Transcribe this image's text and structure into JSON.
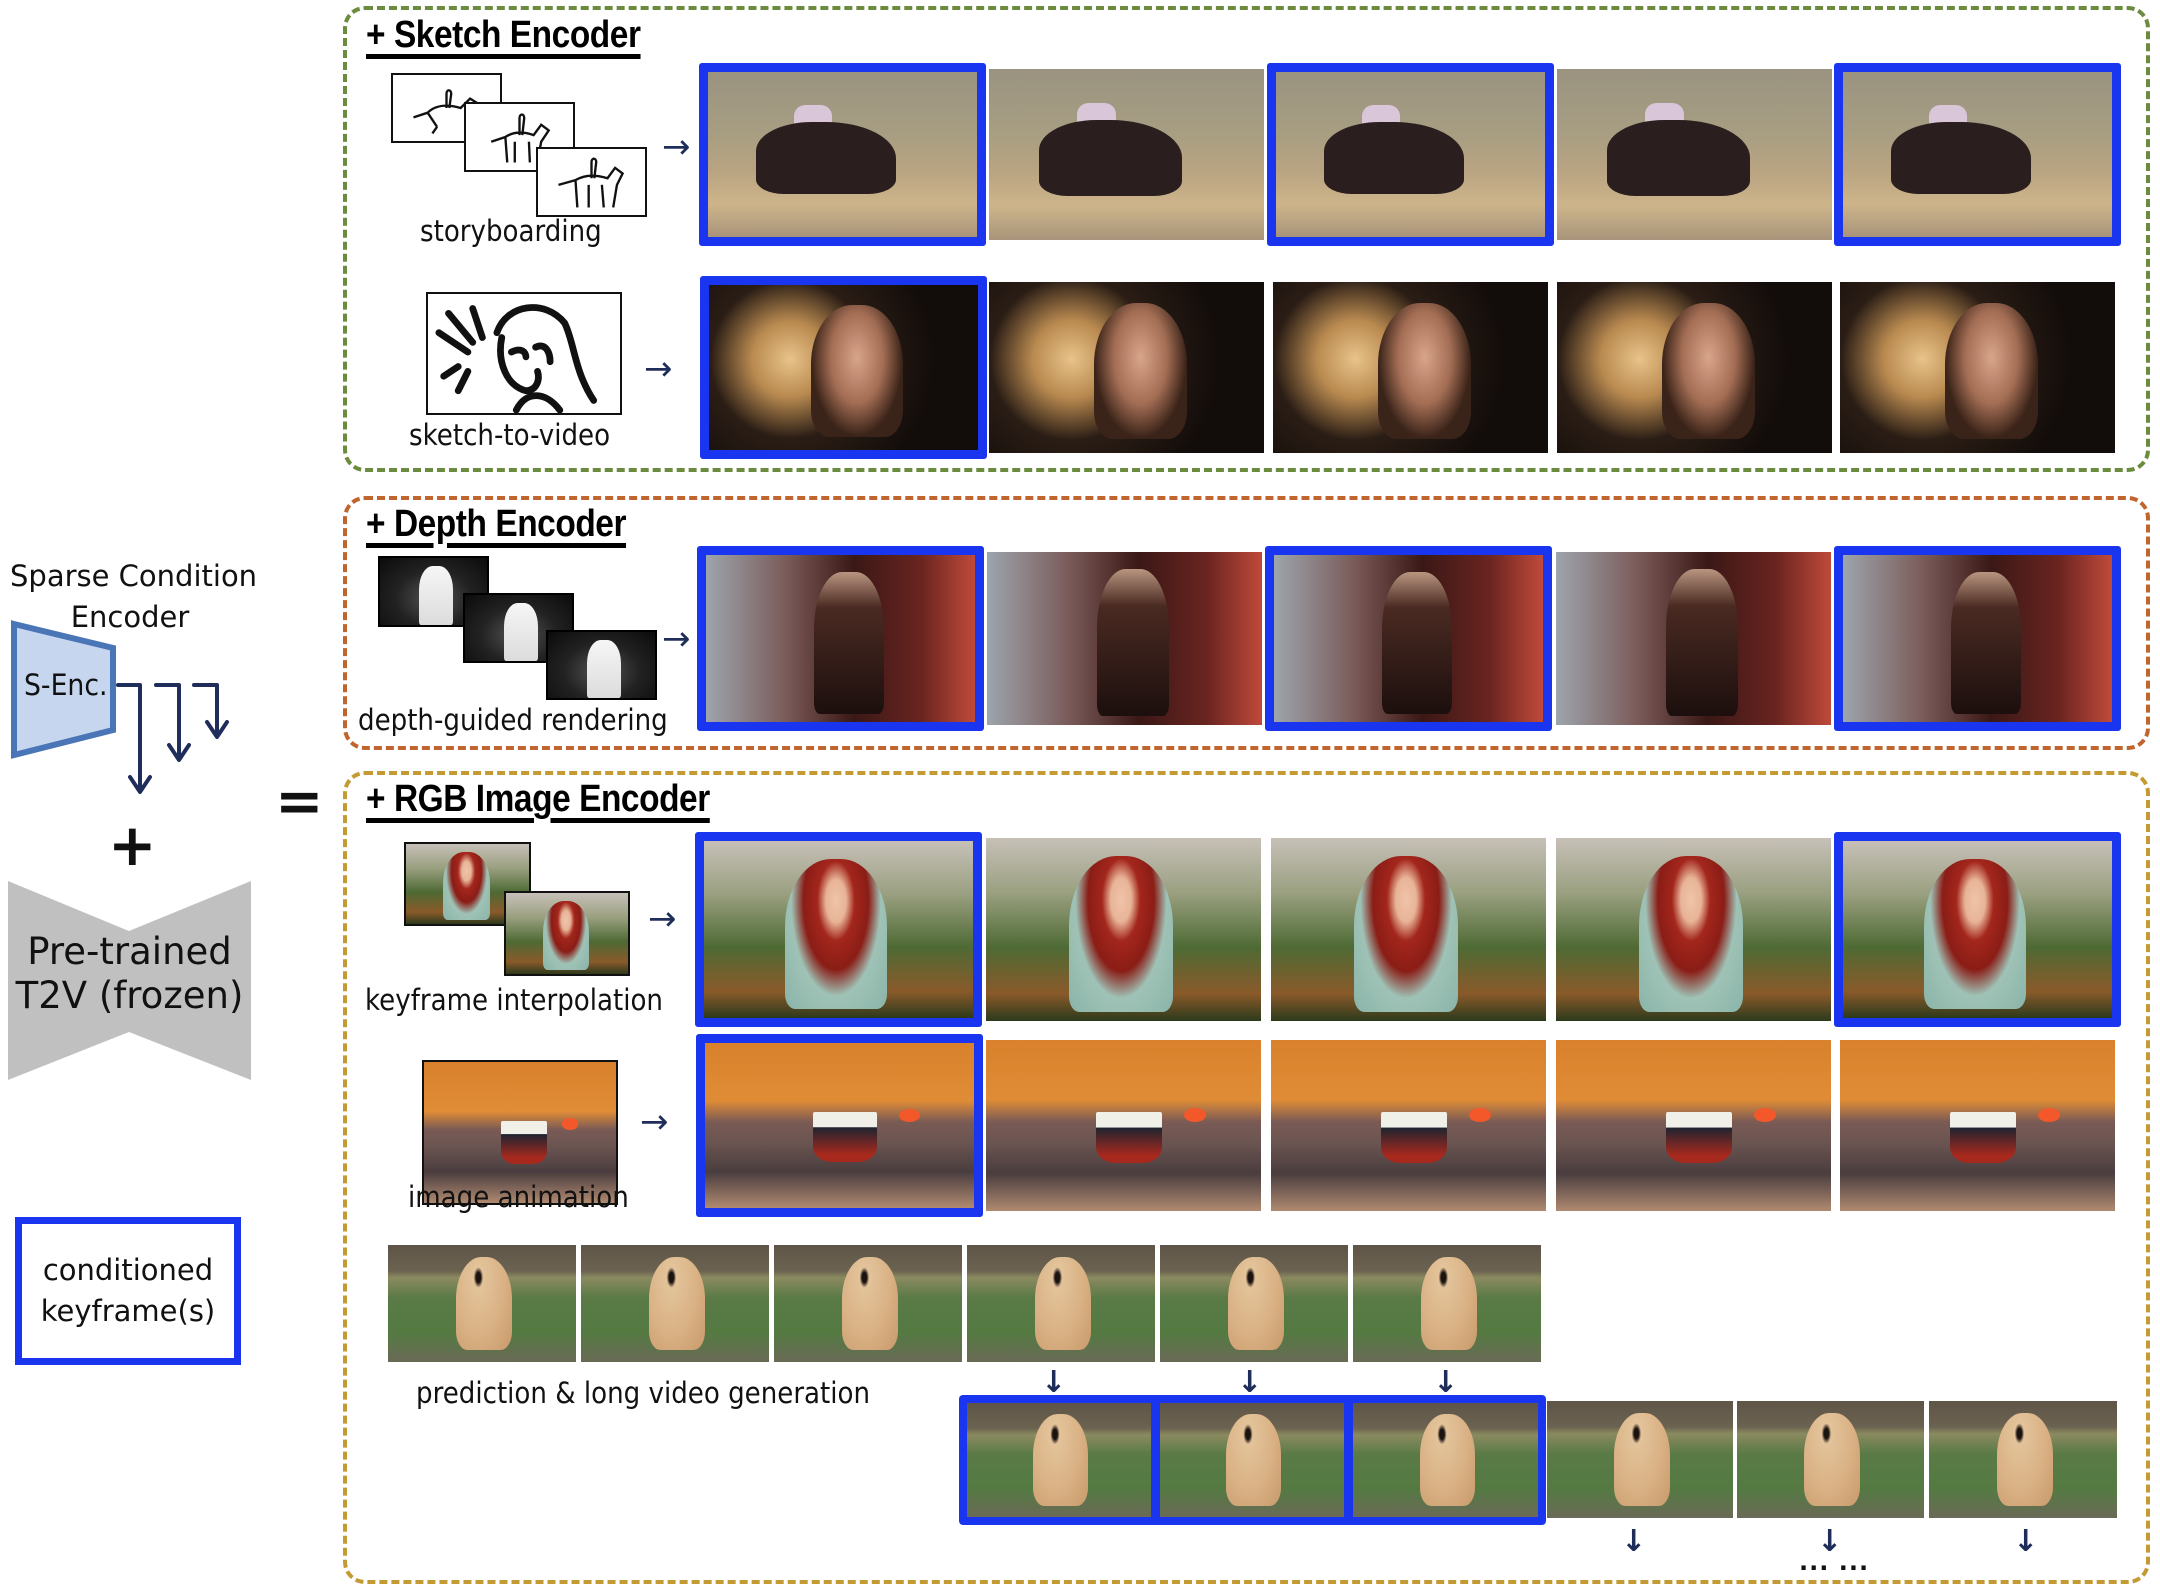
{
  "left_panel": {
    "encoder_caption": "Sparse Condition\nEncoder",
    "encoder_caption_line1": "Sparse Condition",
    "encoder_caption_line2": "Encoder",
    "encoder_block_label": "S-Enc.",
    "plus_symbol": "+",
    "backbone_label_line1": "Pre-trained",
    "backbone_label_line2": "T2V (frozen)",
    "equals_symbol": "=",
    "legend_line1": "conditioned",
    "legend_line2": "keyframe(s)",
    "colors": {
      "encoder_fill": "#c5d6ee",
      "encoder_stroke": "#4a75b6",
      "backbone_fill": "#c0c0c0",
      "arrow": "#1f2d5a",
      "keyframe_border": "#1a35f0"
    }
  },
  "sections": [
    {
      "id": "sketch",
      "title": "+ Sketch Encoder",
      "border_color": "#6b8c3e",
      "tasks": [
        {
          "label": "storyboarding",
          "input": "sketch-sequence (3 sketches)",
          "scene": "horse-rider",
          "keyframes": [
            true,
            false,
            true,
            false,
            true
          ]
        },
        {
          "label": "sketch-to-video",
          "input": "single sketch",
          "scene": "woman-fireworks",
          "keyframes": [
            true,
            false,
            false,
            false,
            false
          ]
        }
      ]
    },
    {
      "id": "depth",
      "title": "+ Depth Encoder",
      "border_color": "#c0652e",
      "tasks": [
        {
          "label": "depth-guided rendering",
          "input": "depth-map sequence (3 maps)",
          "scene": "woman-night-street",
          "keyframes": [
            true,
            false,
            true,
            false,
            true
          ]
        }
      ]
    },
    {
      "id": "rgb",
      "title": "+ RGB Image Encoder",
      "border_color": "#c49b33",
      "tasks": [
        {
          "label": "keyframe interpolation",
          "input": "two keyframe images",
          "scene": "anime-girl",
          "keyframes": [
            true,
            false,
            false,
            false,
            true
          ]
        },
        {
          "label": "image animation",
          "input": "single image",
          "scene": "boat-sunset",
          "keyframes": [
            true,
            false,
            false,
            false,
            false
          ]
        },
        {
          "label": "prediction & long video generation",
          "input": "6 context frames",
          "scene": "golden-retriever",
          "context_frames": 6,
          "generated_keyframes": 3,
          "generated_frames": 3,
          "continuation": "... ..."
        }
      ]
    }
  ],
  "symbols": {
    "arrow_right": "→",
    "arrow_down": "↓"
  }
}
